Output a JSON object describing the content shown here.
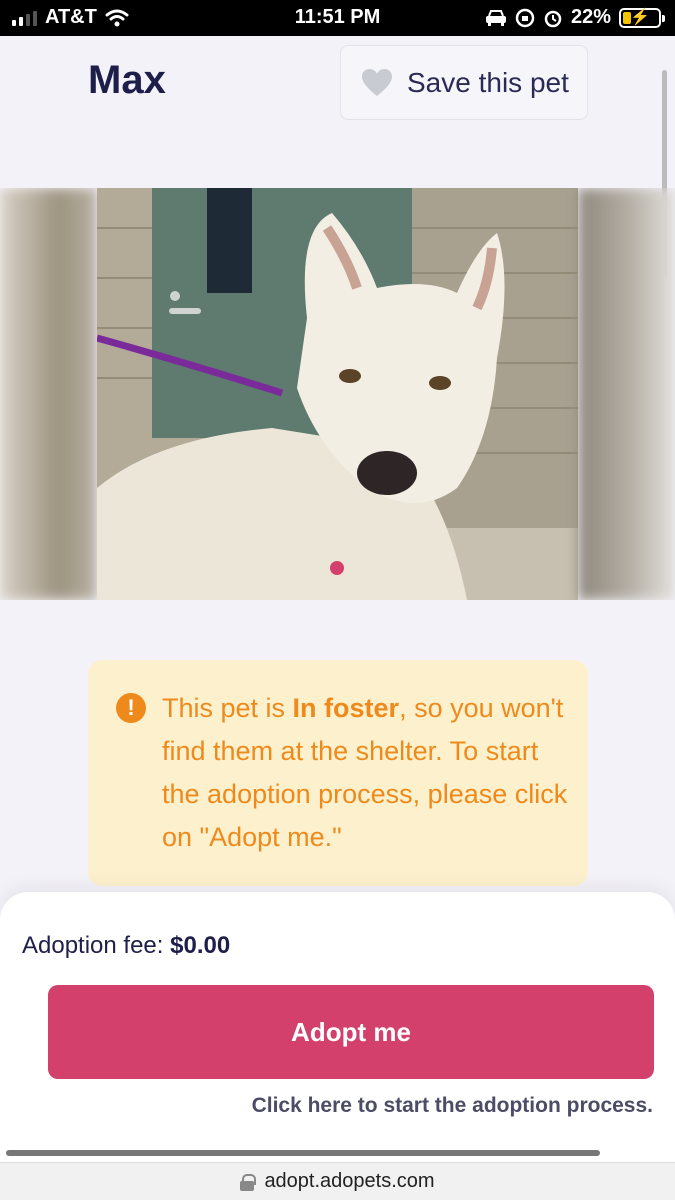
{
  "status_bar": {
    "carrier": "AT&T",
    "time": "11:51 PM",
    "battery": "22%",
    "icons": [
      "signal-icon",
      "wifi-icon",
      "car-icon",
      "rotation-lock-icon",
      "alarm-icon",
      "battery-charging-icon"
    ]
  },
  "header": {
    "pet_name": "Max",
    "save_label": "Save this pet",
    "save_icon": "heart-icon"
  },
  "photo": {
    "description_icon": "dog-photo"
  },
  "notice": {
    "icon": "warning-icon",
    "prefix": "This pet is ",
    "status": "In foster",
    "suffix": ", so you won't find them at the shelter. To start the adoption process, please click on \"Adopt me.\"",
    "color": "#ee8a1c",
    "background": "#fdf1cd"
  },
  "adoption": {
    "fee_label": "Adoption fee:",
    "fee_value": "$0.00",
    "button_label": "Adopt me",
    "button_color": "#d2406b",
    "hint": "Click here to start the adoption process."
  },
  "browser": {
    "url": "adopt.adopets.com"
  }
}
